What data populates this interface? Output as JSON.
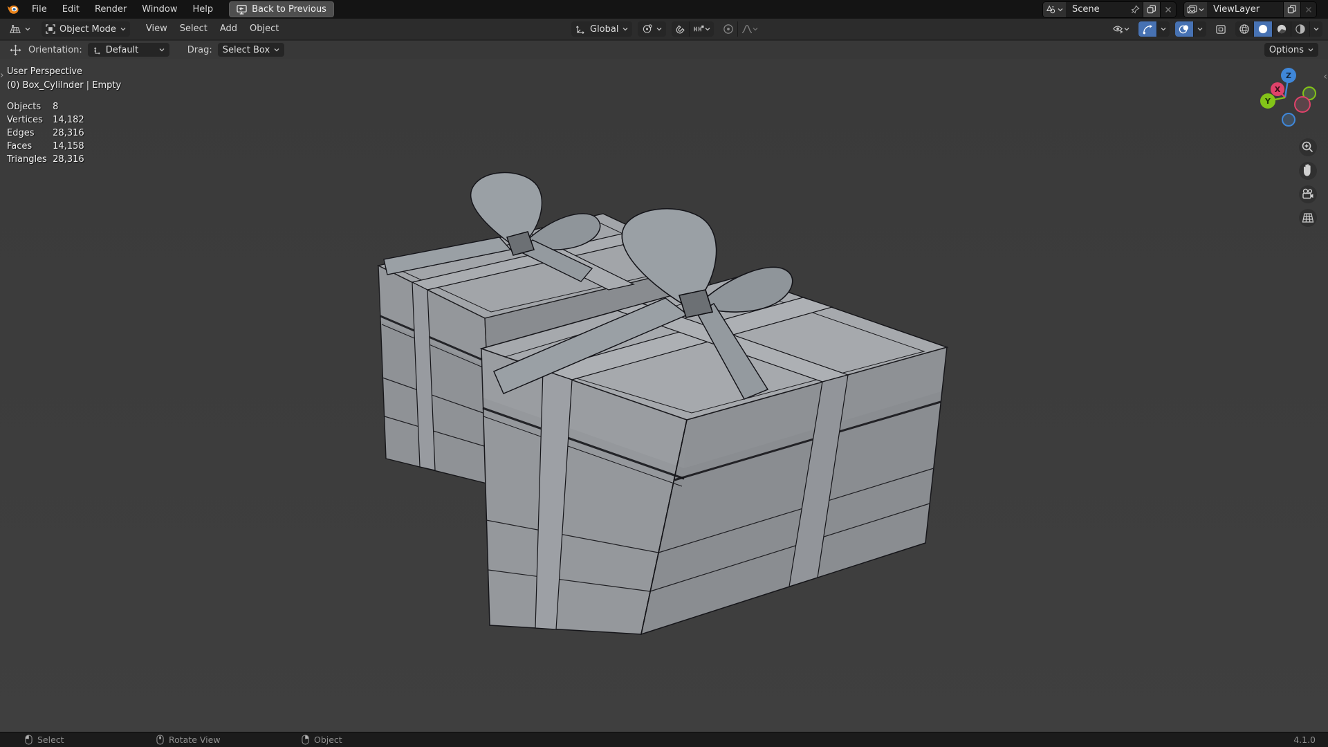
{
  "topbar": {
    "menus": [
      "File",
      "Edit",
      "Render",
      "Window",
      "Help"
    ],
    "back_button": "Back to Previous",
    "scene_label": "Scene",
    "viewlayer_label": "ViewLayer"
  },
  "header": {
    "mode": "Object Mode",
    "menus": [
      "View",
      "Select",
      "Add",
      "Object"
    ],
    "orientation": "Global",
    "options": "Options"
  },
  "tools": {
    "orientation_label": "Orientation:",
    "orientation_value": "Default",
    "drag_label": "Drag:",
    "drag_value": "Select Box"
  },
  "overlay": {
    "view_name": "User Perspective",
    "context": "(0) Box_Cylilnder | Empty",
    "stats": [
      {
        "label": "Objects",
        "value": "8"
      },
      {
        "label": "Vertices",
        "value": "14,182"
      },
      {
        "label": "Edges",
        "value": "28,316"
      },
      {
        "label": "Faces",
        "value": "14,158"
      },
      {
        "label": "Triangles",
        "value": "28,316"
      }
    ]
  },
  "gizmo": {
    "x": "X",
    "y": "Y",
    "z": "Z"
  },
  "status": {
    "items": [
      {
        "button": "left-mouse",
        "label": "Select"
      },
      {
        "button": "middle-mouse",
        "label": "Rotate View"
      },
      {
        "button": "right-mouse",
        "label": "Object"
      }
    ],
    "version": "4.1.0"
  },
  "colors": {
    "accent_blue": "#4772b3",
    "axis_x": "#e0426a",
    "axis_y": "#83c418",
    "axis_z": "#3f87d9",
    "viewport_bg": "#3d3d3d",
    "topbar_bg": "#141414",
    "header_bg": "#2c2c2c",
    "box_top": "#a6a9ad",
    "box_side": "#8a8d91"
  }
}
